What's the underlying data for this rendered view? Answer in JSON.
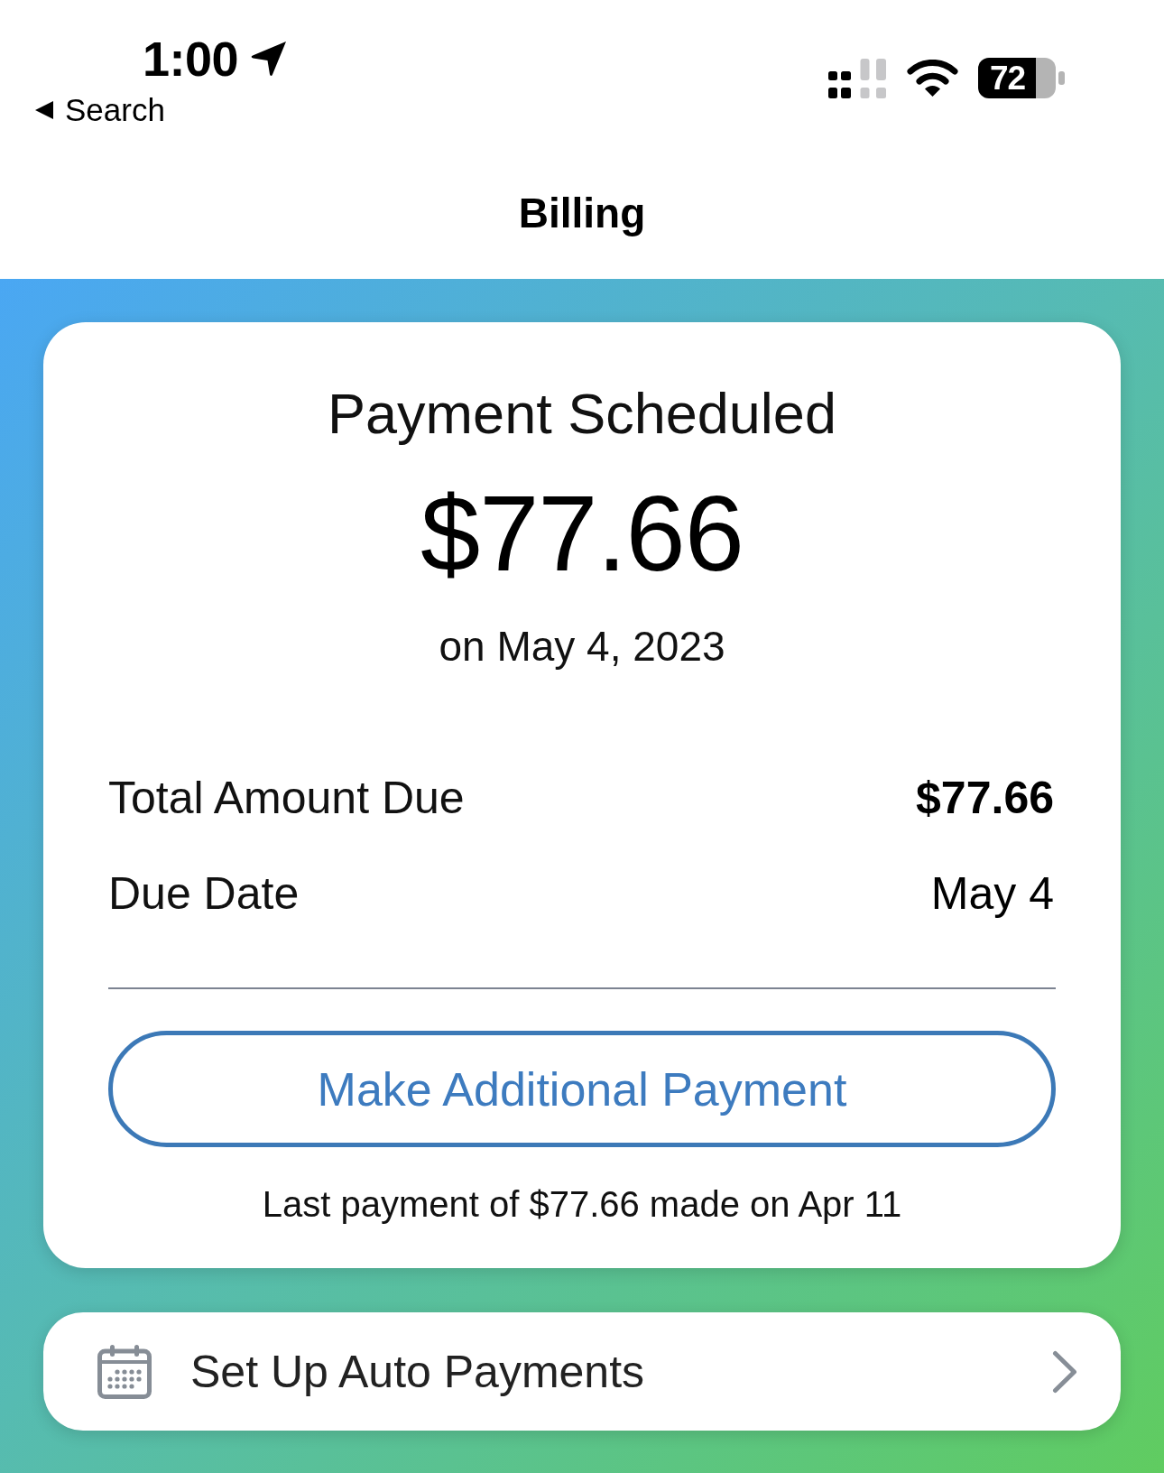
{
  "status_bar": {
    "time": "1:00",
    "back_label": "Search",
    "battery": "72"
  },
  "nav": {
    "title": "Billing"
  },
  "payment_card": {
    "status": "Payment Scheduled",
    "amount": "$77.66",
    "date": "on May 4, 2023",
    "details": [
      {
        "label": "Total Amount Due",
        "value": "$77.66",
        "bold": true
      },
      {
        "label": "Due Date",
        "value": "May 4",
        "bold": false
      }
    ],
    "button": "Make Additional Payment",
    "last_payment": "Last payment of $77.66 made on Apr 11"
  },
  "auto_pay": {
    "label": "Set Up Auto Payments"
  }
}
